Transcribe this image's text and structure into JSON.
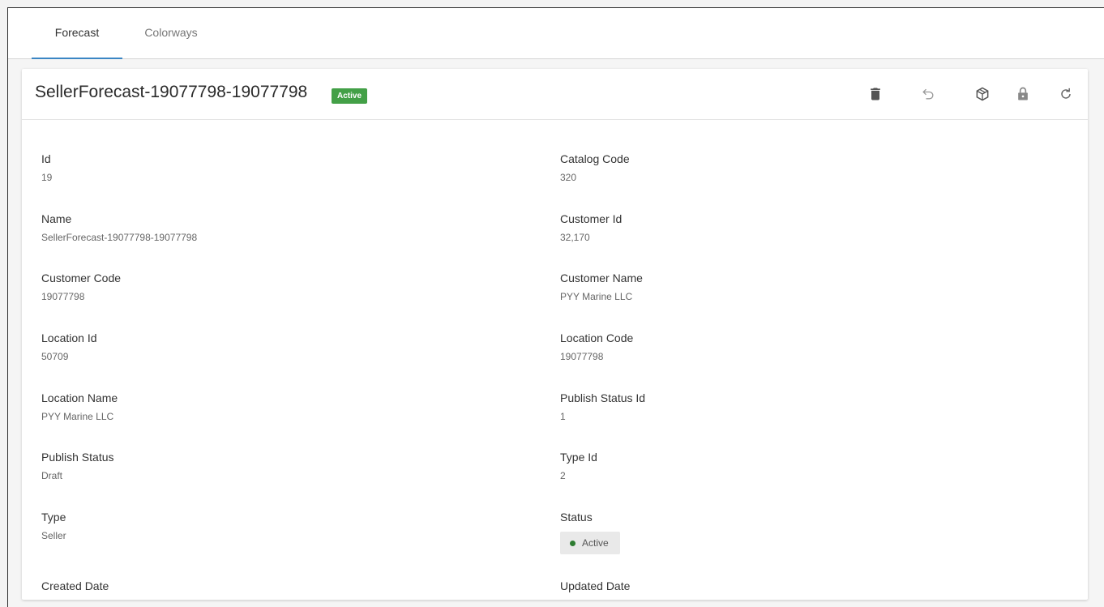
{
  "tabs": [
    {
      "label": "Forecast",
      "active": true
    },
    {
      "label": "Colorways",
      "active": false
    }
  ],
  "header": {
    "title": "SellerForecast-19077798-19077798",
    "badge": "Active",
    "badge_color": "#43a047",
    "actions": [
      {
        "name": "delete-icon"
      },
      {
        "name": "undo-icon"
      },
      {
        "name": "package-icon"
      },
      {
        "name": "lock-icon"
      },
      {
        "name": "refresh-icon"
      }
    ]
  },
  "fields": {
    "id": {
      "label": "Id",
      "value": "19"
    },
    "catalog_code": {
      "label": "Catalog Code",
      "value": "320"
    },
    "name": {
      "label": "Name",
      "value": "SellerForecast-19077798-19077798"
    },
    "customer_id": {
      "label": "Customer Id",
      "value": "32,170"
    },
    "customer_code": {
      "label": "Customer Code",
      "value": "19077798"
    },
    "customer_name": {
      "label": "Customer Name",
      "value": "PYY Marine LLC"
    },
    "location_id": {
      "label": "Location Id",
      "value": "50709"
    },
    "location_code": {
      "label": "Location Code",
      "value": "19077798"
    },
    "location_name": {
      "label": "Location Name",
      "value": "PYY Marine LLC"
    },
    "publish_status_id": {
      "label": "Publish Status Id",
      "value": "1"
    },
    "publish_status": {
      "label": "Publish Status",
      "value": "Draft"
    },
    "type_id": {
      "label": "Type Id",
      "value": "2"
    },
    "type": {
      "label": "Type",
      "value": "Seller"
    },
    "status": {
      "label": "Status",
      "value": "Active",
      "dot_color": "#2e7d32"
    },
    "created_date": {
      "label": "Created Date"
    },
    "updated_date": {
      "label": "Updated Date"
    }
  }
}
